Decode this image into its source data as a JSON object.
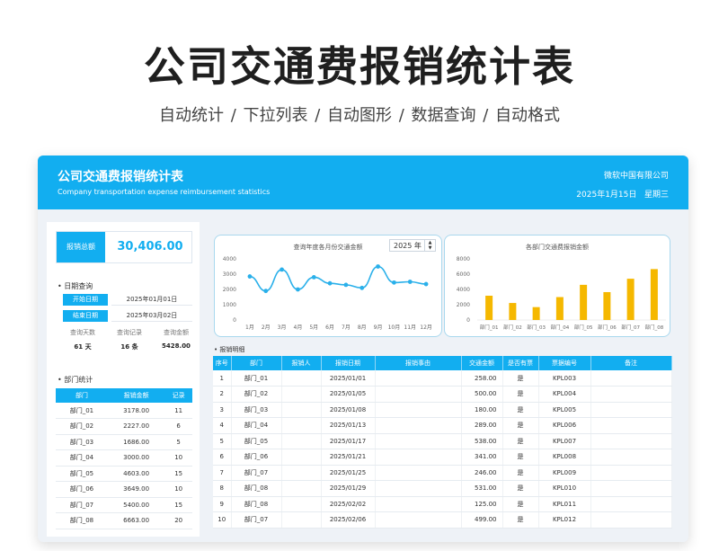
{
  "header": {
    "title": "公司交通费报销统计表",
    "subtitle": "自动统计 / 下拉列表 / 自动图形 / 数据查询 / 自动格式"
  },
  "banner": {
    "title": "公司交通费报销统计表",
    "subtitle": "Company transportation expense reimbursement statistics",
    "company": "微软中国有限公司",
    "date": "2025年1月15日",
    "weekday": "星期三"
  },
  "summary": {
    "label": "报销总额",
    "value": "30,406.00"
  },
  "date_query": {
    "section": "日期查询",
    "start_label": "开始日期",
    "start_value": "2025年01月01日",
    "end_label": "结束日期",
    "end_value": "2025年03月02日",
    "stats": [
      {
        "head": "查询天数",
        "value": "61 天"
      },
      {
        "head": "查询记录",
        "value": "16 条"
      },
      {
        "head": "查询金额",
        "value": "5428.00"
      }
    ]
  },
  "dept_stats": {
    "section": "部门统计",
    "headers": [
      "部门",
      "报销金额",
      "记录"
    ],
    "rows": [
      [
        "部门_01",
        "3178.00",
        "11"
      ],
      [
        "部门_02",
        "2227.00",
        "6"
      ],
      [
        "部门_03",
        "1686.00",
        "5"
      ],
      [
        "部门_04",
        "3000.00",
        "10"
      ],
      [
        "部门_05",
        "4603.00",
        "15"
      ],
      [
        "部门_06",
        "3649.00",
        "10"
      ],
      [
        "部门_07",
        "5400.00",
        "15"
      ],
      [
        "部门_08",
        "6663.00",
        "20"
      ]
    ]
  },
  "year_select": {
    "value": "2025 年",
    "up": "▲",
    "down": "▼"
  },
  "detail": {
    "section": "报销明细",
    "headers": [
      "序号",
      "部门",
      "报销人",
      "报销日期",
      "报销事由",
      "交通金额",
      "是否有票",
      "票据编号",
      "备注"
    ],
    "rows": [
      [
        "1",
        "部门_01",
        "",
        "2025/01/01",
        "",
        "258.00",
        "是",
        "KPL003",
        ""
      ],
      [
        "2",
        "部门_02",
        "",
        "2025/01/05",
        "",
        "500.00",
        "是",
        "KPL004",
        ""
      ],
      [
        "3",
        "部门_03",
        "",
        "2025/01/08",
        "",
        "180.00",
        "是",
        "KPL005",
        ""
      ],
      [
        "4",
        "部门_04",
        "",
        "2025/01/13",
        "",
        "289.00",
        "是",
        "KPL006",
        ""
      ],
      [
        "5",
        "部门_05",
        "",
        "2025/01/17",
        "",
        "538.00",
        "是",
        "KPL007",
        ""
      ],
      [
        "6",
        "部门_06",
        "",
        "2025/01/21",
        "",
        "341.00",
        "是",
        "KPL008",
        ""
      ],
      [
        "7",
        "部门_07",
        "",
        "2025/01/25",
        "",
        "246.00",
        "是",
        "KPL009",
        ""
      ],
      [
        "8",
        "部门_08",
        "",
        "2025/01/29",
        "",
        "531.00",
        "是",
        "KPL010",
        ""
      ],
      [
        "9",
        "部门_08",
        "",
        "2025/02/02",
        "",
        "125.00",
        "是",
        "KPL011",
        ""
      ],
      [
        "10",
        "部门_07",
        "",
        "2025/02/06",
        "",
        "499.00",
        "是",
        "KPL012",
        ""
      ]
    ]
  },
  "colors": {
    "accent": "#12aef0",
    "bar": "#f5b800",
    "line": "#2ab0ea"
  },
  "chart_data": [
    {
      "type": "line",
      "title": "查询年度各月份交通金额",
      "categories": [
        "1月",
        "2月",
        "3月",
        "4月",
        "5月",
        "6月",
        "7月",
        "8月",
        "9月",
        "10月",
        "11月",
        "12月"
      ],
      "values": [
        2850,
        1900,
        3300,
        2000,
        2800,
        2400,
        2300,
        2100,
        3500,
        2450,
        2500,
        2350
      ],
      "ylim": [
        0,
        4000
      ],
      "yticks": [
        "0",
        "1000",
        "2000",
        "3000",
        "4000"
      ],
      "grid": false
    },
    {
      "type": "bar",
      "title": "各部门交通费报销金额",
      "categories": [
        "部门_01",
        "部门_02",
        "部门_03",
        "部门_04",
        "部门_05",
        "部门_06",
        "部门_07",
        "部门_08"
      ],
      "values": [
        3178,
        2227,
        1686,
        3000,
        4603,
        3649,
        5400,
        6663
      ],
      "ylim": [
        0,
        8000
      ],
      "yticks": [
        "0",
        "2000",
        "4000",
        "6000",
        "8000"
      ],
      "grid": false
    }
  ]
}
